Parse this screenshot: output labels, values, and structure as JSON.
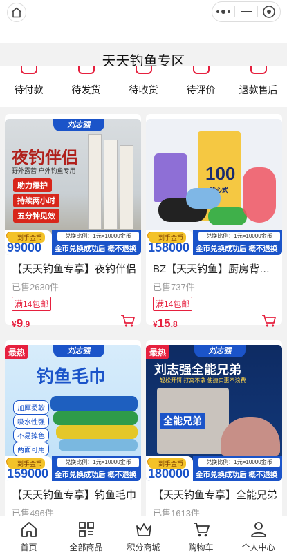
{
  "header": {
    "title": "天天钓鱼专区"
  },
  "order_status": [
    {
      "label": "待付款"
    },
    {
      "label": "待发货"
    },
    {
      "label": "待收货"
    },
    {
      "label": "待评价"
    },
    {
      "label": "退款售后"
    }
  ],
  "products": [
    {
      "title": "【天天钓鱼专享】夜钓伴侣",
      "sold": "已售2630件",
      "shipping": "满14包邮",
      "price_currency": "¥",
      "price_int": "9",
      "price_dec": ".9",
      "hot": "",
      "brand": "刘志强",
      "coin_label": "到手金币",
      "coins": "99000",
      "ratio": "兑换比例：1元=10000金币",
      "exchange_note": "金币兑换成功后 概不退换",
      "image_text": [
        "夜钓伴侣",
        "野外露营 户外钓鱼专用",
        "助力爆护",
        "持续两小时",
        "五分钟见效"
      ]
    },
    {
      "title": "BZ【天天钓鱼】厨房背心式垃圾袋",
      "sold": "已售737件",
      "shipping": "满14包邮",
      "price_currency": "¥",
      "price_int": "15",
      "price_dec": ".8",
      "hot": "",
      "brand": "",
      "coin_label": "到手金币",
      "coins": "158000",
      "ratio": "兑换比例：1元=10000金币",
      "exchange_note": "金币兑换成功后 概不退换",
      "image_text": [
        "100",
        "背心式"
      ]
    },
    {
      "title": "【天天钓鱼专享】钓鱼毛巾",
      "sold": "已售496件",
      "shipping": "",
      "price_currency": "",
      "price_int": "",
      "price_dec": "",
      "hot": "最热",
      "brand": "刘志强",
      "coin_label": "到手金币",
      "coins": "159000",
      "ratio": "兑换比例：1元=10000金币",
      "exchange_note": "金币兑换成功后 概不退换",
      "image_text": [
        "钓鱼毛巾",
        "加厚柔软",
        "吸水性强",
        "不易掉色",
        "两面可用"
      ]
    },
    {
      "title": "【天天钓鱼专享】全能兄弟",
      "sold": "已售1613件",
      "shipping": "",
      "price_currency": "",
      "price_int": "",
      "price_dec": "",
      "hot": "最热",
      "brand": "刘志强",
      "coin_label": "到手金币",
      "coins": "180000",
      "ratio": "兑换比例：1元=10000金币",
      "exchange_note": "金币兑换成功后 概不退换",
      "image_text": [
        "刘志强全能兄弟",
        "轻松开饵 打窝不散 使捷实惠不浪费",
        "全能兄弟"
      ]
    }
  ],
  "tabbar": [
    {
      "label": "首页",
      "icon": "home-icon"
    },
    {
      "label": "全部商品",
      "icon": "grid-icon"
    },
    {
      "label": "积分商城",
      "icon": "crown-icon"
    },
    {
      "label": "购物车",
      "icon": "cart-icon"
    },
    {
      "label": "个人中心",
      "icon": "user-icon"
    }
  ],
  "colors": {
    "accent": "#e6203e",
    "brand_blue": "#1b54c9"
  }
}
